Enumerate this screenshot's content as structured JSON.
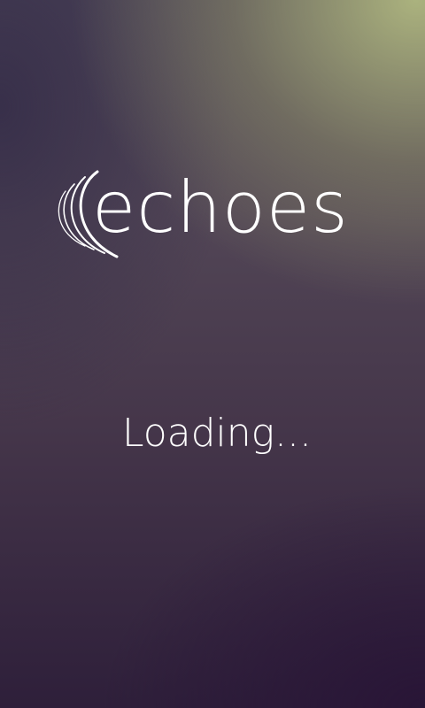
{
  "app": {
    "name": "echoes",
    "logo_icon": "sound-waves-icon"
  },
  "status": {
    "loading_text": "Loading..."
  },
  "colors": {
    "text": "#ffffff",
    "background_top_right": "#b0b880",
    "background_bottom": "#2e1f3a"
  }
}
